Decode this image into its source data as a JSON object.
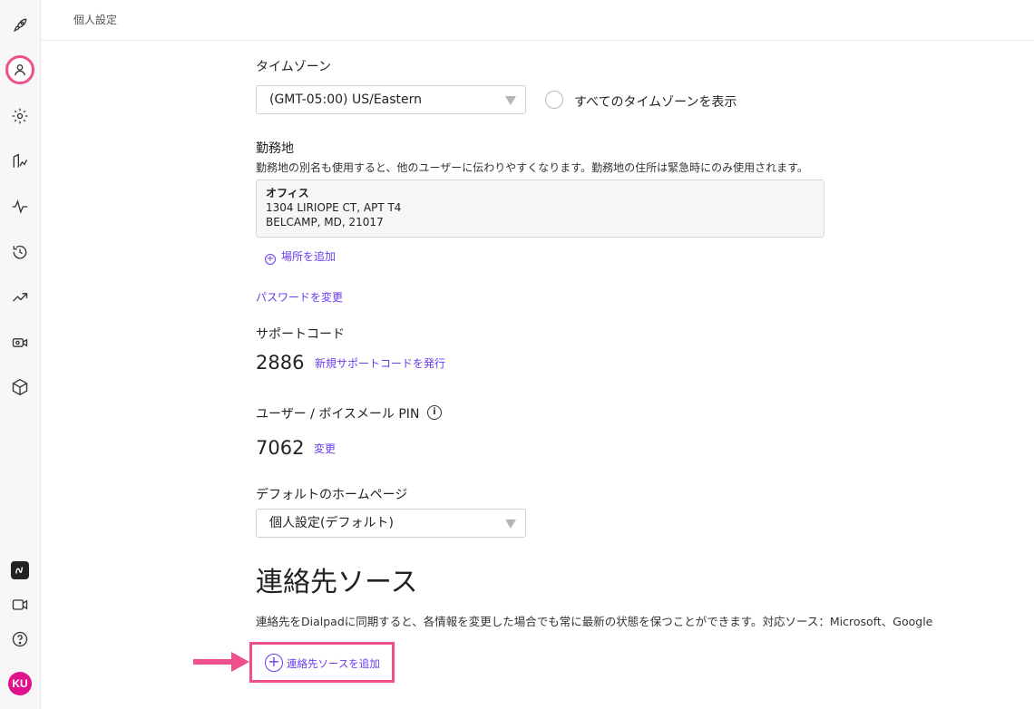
{
  "header": {
    "breadcrumb": "個人設定"
  },
  "sidebar": {
    "top_icons": [
      "rocket-icon",
      "user-icon",
      "gear-icon",
      "building-chart-icon",
      "activity-icon",
      "history-icon",
      "trending-icon",
      "video-camera-icon",
      "cube-icon"
    ],
    "bottom_icons": [
      "app-logo-icon",
      "video-icon",
      "help-icon"
    ],
    "avatar_initials": "KU",
    "active_color": "#ef4f8c"
  },
  "timezone": {
    "label": "タイムゾーン",
    "selected": "(GMT-05:00) US/Eastern",
    "show_all_label": "すべてのタイムゾーンを表示"
  },
  "work_location": {
    "label": "勤務地",
    "description": "勤務地の別名も使用すると、他のユーザーに伝わりやすくなります。勤務地の住所は緊急時にのみ使用されます。",
    "name": "オフィス",
    "address_line1": "1304 LIRIOPE CT, APT T4",
    "address_line2": "BELCAMP, MD, 21017",
    "add_label": "場所を追加"
  },
  "password": {
    "change_label": "パスワードを変更"
  },
  "support_code": {
    "label": "サポートコード",
    "value": "2886",
    "new_label": "新規サポートコードを発行"
  },
  "pin": {
    "label": "ユーザー / ボイスメール PIN",
    "value": "7062",
    "change_label": "変更"
  },
  "homepage": {
    "label": "デフォルトのホームページ",
    "selected": "個人設定(デフォルト)"
  },
  "contact_sources": {
    "heading": "連絡先ソース",
    "description": "連絡先をDialpadに同期すると、各情報を変更した場合でも常に最新の状態を保つことができます。対応ソース：Microsoft、Google",
    "add_label": "連絡先ソースを追加"
  },
  "colors": {
    "accent": "#6a3cf0",
    "highlight": "#ef4f8c",
    "avatar": "#e1118c"
  }
}
